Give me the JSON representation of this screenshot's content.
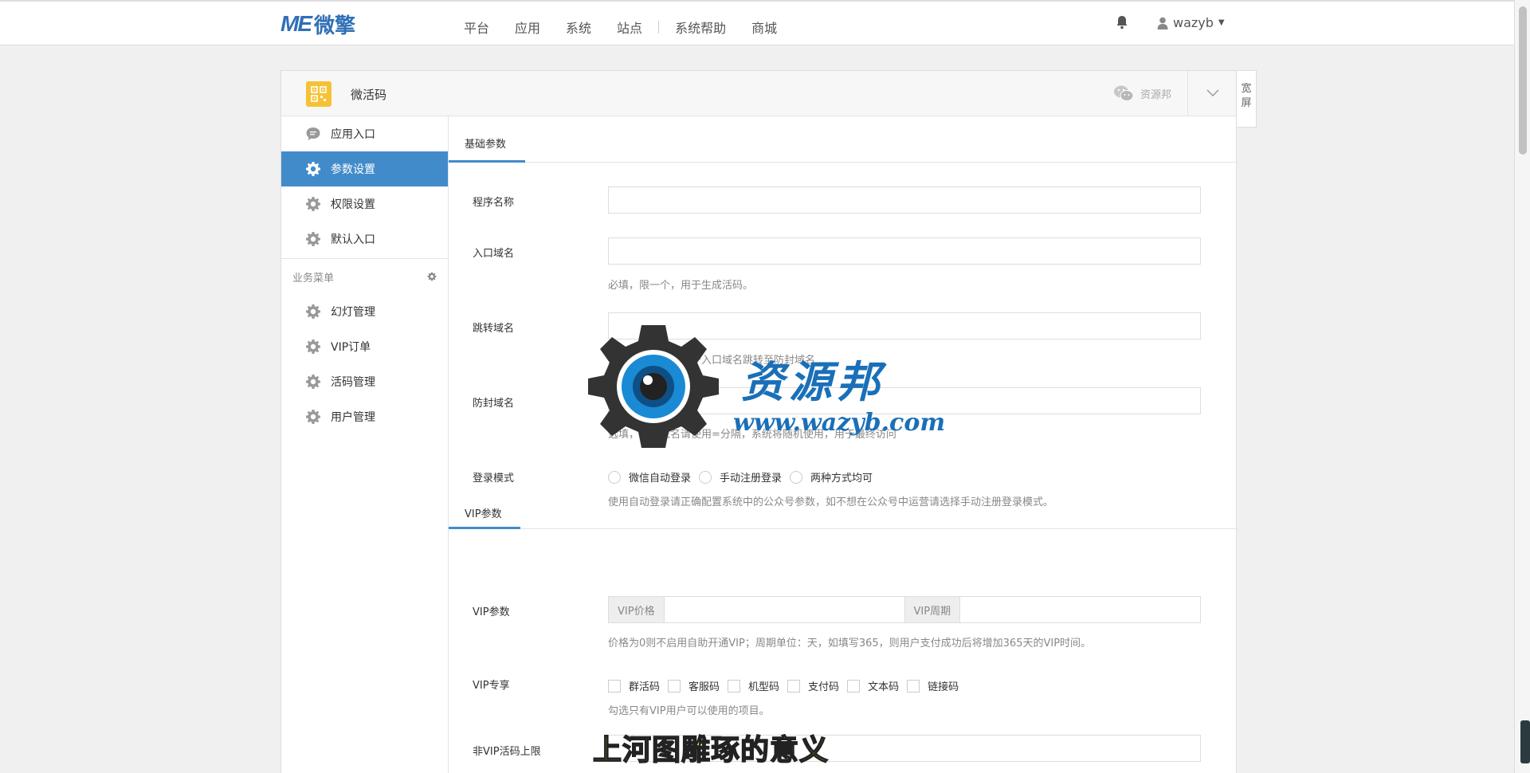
{
  "topbar": {
    "logo_me": "ME",
    "logo_cn": "微擎",
    "nav": [
      "平台",
      "应用",
      "系统",
      "站点",
      "系统帮助",
      "商城"
    ],
    "username": "wazyb"
  },
  "panel": {
    "app_title": "微活码",
    "wechat_label": "资源邦",
    "wide_label_1": "宽",
    "wide_label_2": "屏"
  },
  "sidebar": {
    "items": [
      {
        "label": "应用入口",
        "icon": "chat-bubble-icon"
      },
      {
        "label": "参数设置",
        "icon": "gear-icon",
        "active": true
      },
      {
        "label": "权限设置",
        "icon": "gear-icon"
      },
      {
        "label": "默认入口",
        "icon": "gear-icon"
      }
    ],
    "group_title": "业务菜单",
    "group_items": [
      {
        "label": "幻灯管理",
        "icon": "gear-icon"
      },
      {
        "label": "VIP订单",
        "icon": "gear-icon"
      },
      {
        "label": "活码管理",
        "icon": "gear-icon"
      },
      {
        "label": "用户管理",
        "icon": "gear-icon"
      }
    ]
  },
  "form": {
    "tab_basic": "基础参数",
    "program_name_label": "程序名称",
    "program_name_value": "",
    "entry_domain_label": "入口域名",
    "entry_domain_value": "",
    "entry_domain_help": "必填，限一个，用于生成活码。",
    "jump_domain_label": "跳转域名",
    "jump_domain_value": "",
    "jump_domain_help": "选填，限一个，用于入口域名跳转至防封域名",
    "anti_domain_label": "防封域名",
    "anti_domain_value": "",
    "anti_domain_help": "选填，多个域名请使用=分隔，系统将随机使用，用于最终访问",
    "login_mode_label": "登录模式",
    "login_options": [
      "微信自动登录",
      "手动注册登录",
      "两种方式均可"
    ],
    "login_help": "使用自动登录请正确配置系统中的公众号参数，如不想在公众号中运营请选择手动注册登录模式。",
    "tab_vip": "VIP参数",
    "vip_param_label": "VIP参数",
    "vip_price_addon": "VIP价格",
    "vip_period_addon": "VIP周期",
    "vip_help": "价格为0则不启用自助开通VIP；周期单位：天，如填写365，则用户支付成功后将增加365天的VIP时间。",
    "vip_exclusive_label": "VIP专享",
    "vip_exclusive_options": [
      "群活码",
      "客服码",
      "机型码",
      "支付码",
      "文本码",
      "链接码"
    ],
    "vip_exclusive_help": "勾选只有VIP用户可以使用的项目。",
    "non_vip_limit_label": "非VIP活码上限"
  },
  "overlay": {
    "watermark_cn": "资源邦",
    "watermark_url": "www.wazyb.com",
    "caption": "上河图雕琢的意义"
  }
}
